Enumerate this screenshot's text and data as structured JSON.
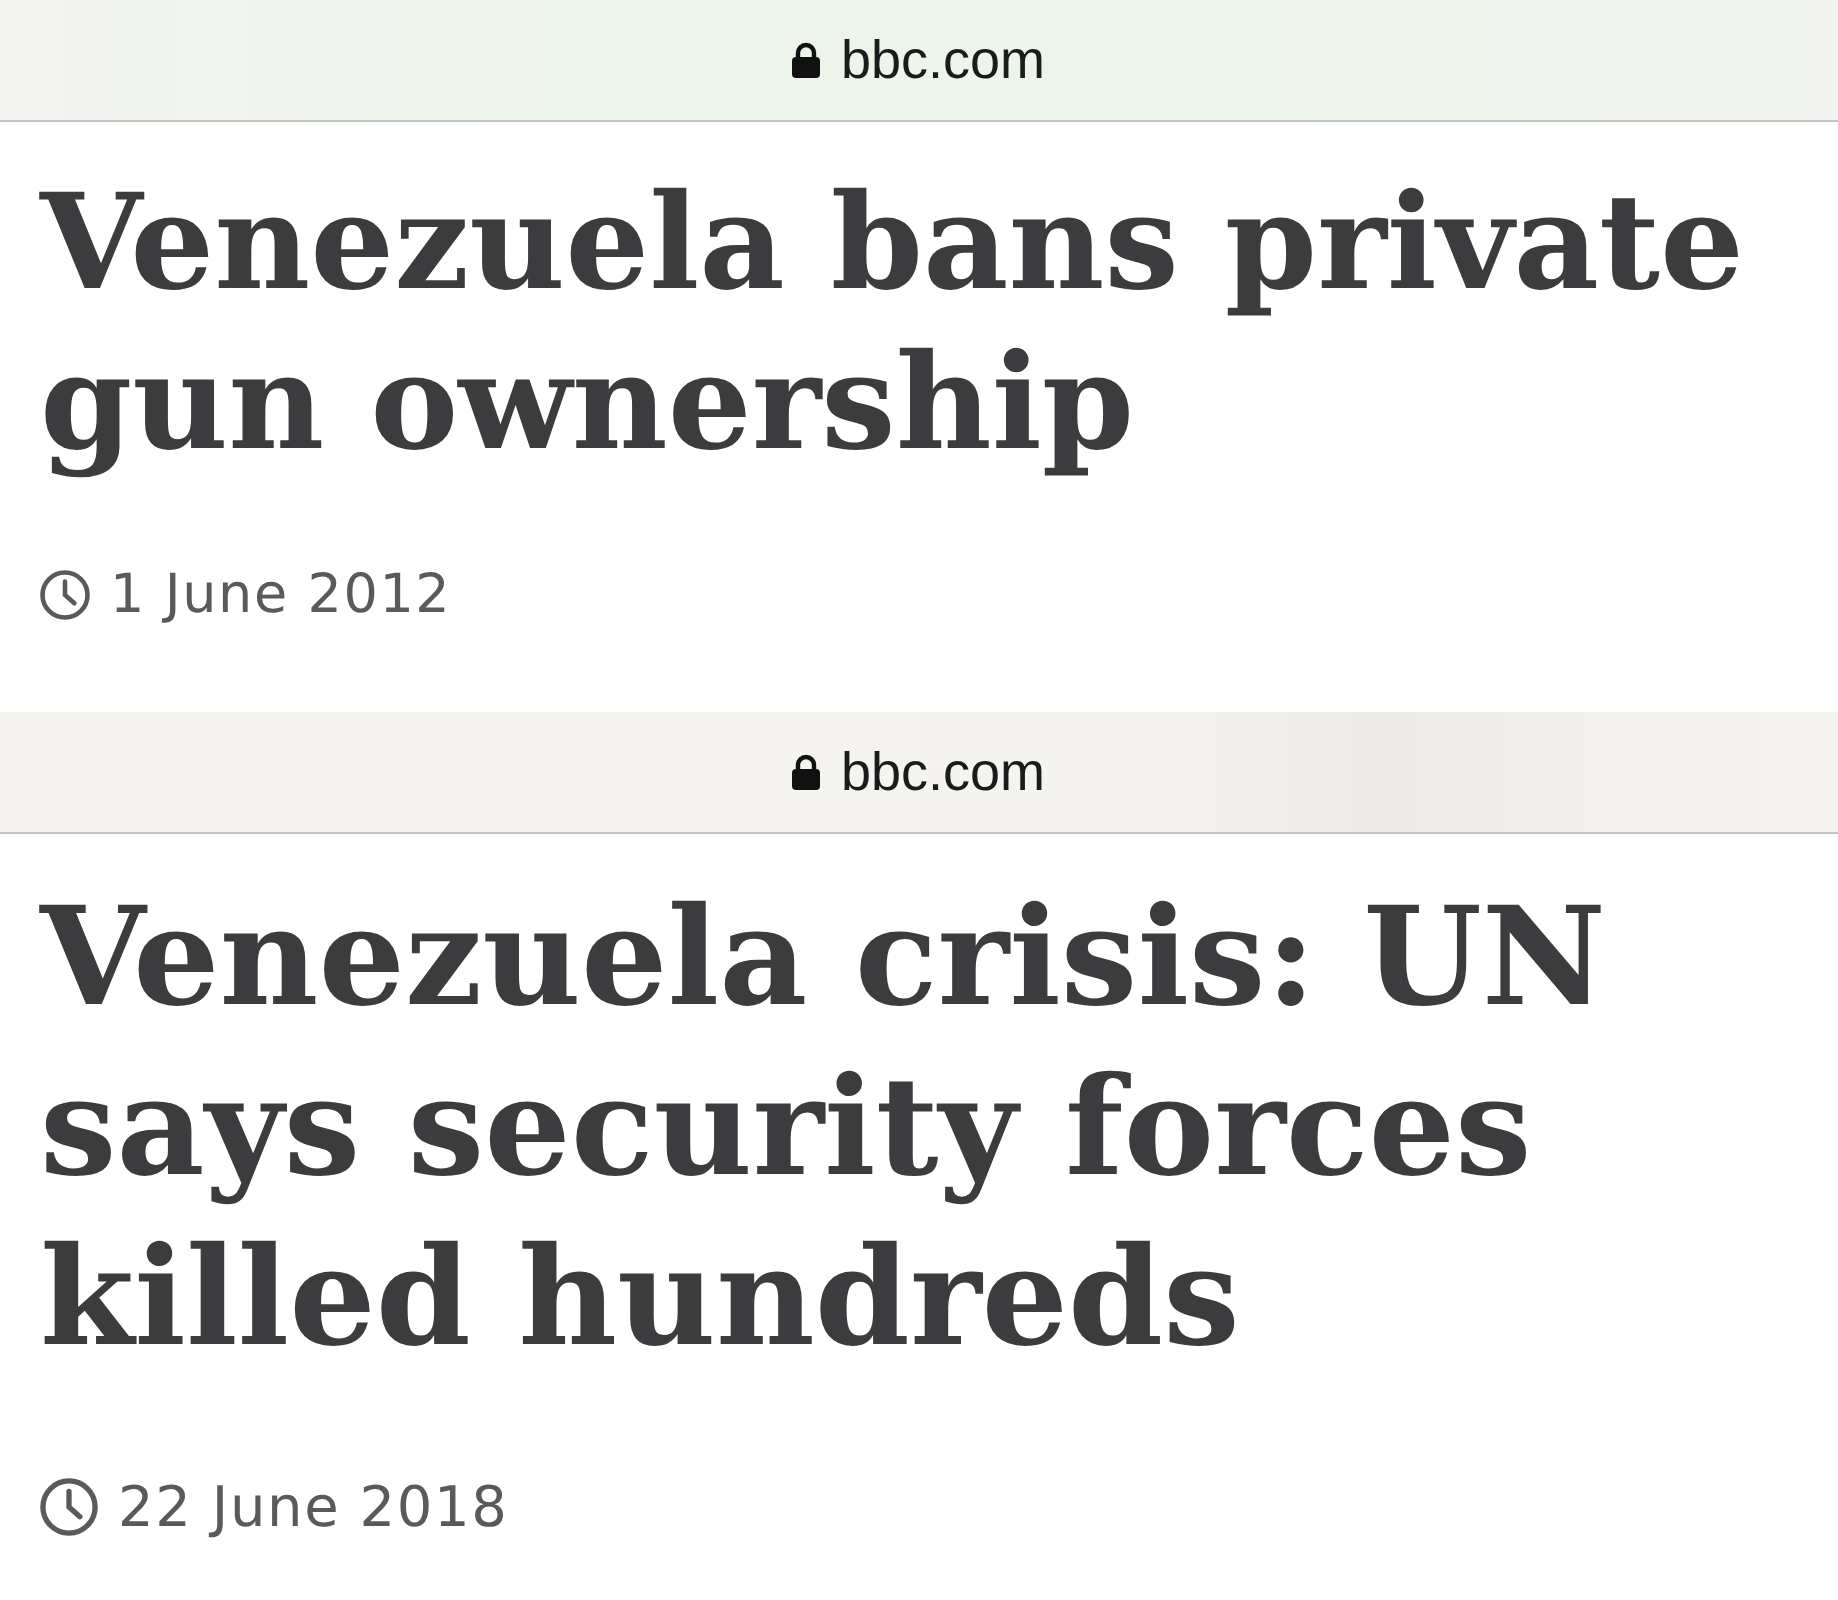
{
  "articles": [
    {
      "address_bar": {
        "domain": "bbc.com"
      },
      "headline": "Venezuela bans private gun ownership",
      "date": "1 June 2012"
    },
    {
      "address_bar": {
        "domain": "bbc.com"
      },
      "headline": "Venezuela crisis: UN says security forces killed hundreds",
      "date": "22 June 2018"
    }
  ]
}
